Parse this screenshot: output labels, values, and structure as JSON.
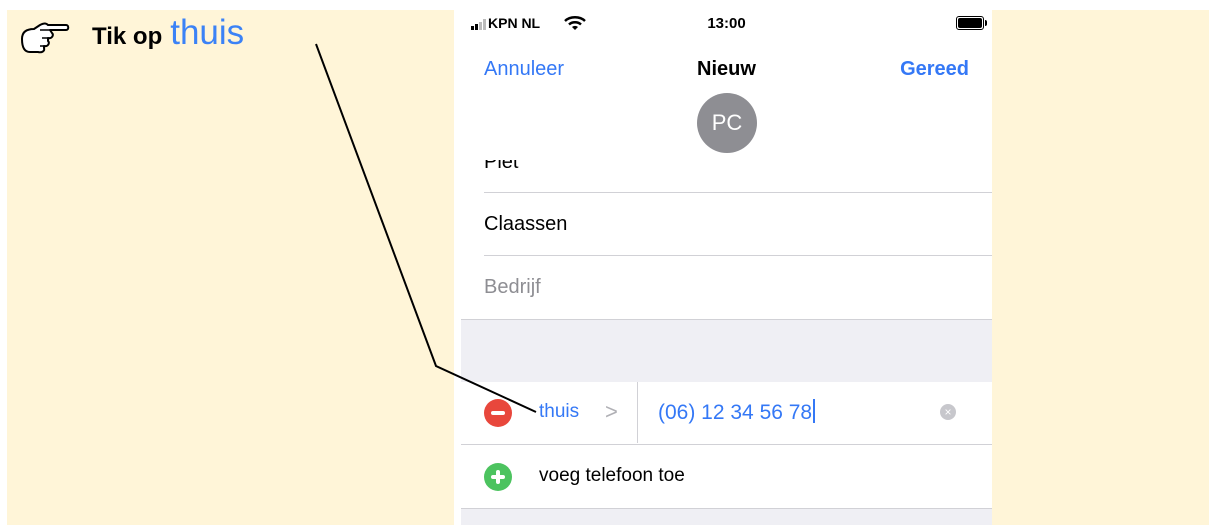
{
  "instruction": {
    "prefix": "Tik op",
    "highlight": "thuis",
    "pointer_icon": "hand-pointing-right-icon"
  },
  "status_bar": {
    "carrier": "KPN NL",
    "time": "13:00",
    "signal_icon": "signal-bars-icon",
    "wifi_icon": "wifi-icon",
    "battery_icon": "battery-icon"
  },
  "nav": {
    "cancel": "Annuleer",
    "title": "Nieuw",
    "done": "Gereed"
  },
  "avatar": {
    "initials": "PC"
  },
  "fields": {
    "first_name": "Piet",
    "last_name": "Claassen",
    "company_placeholder": "Bedrijf"
  },
  "phone": {
    "label": "thuis",
    "chevron": ">",
    "value": "(06) 12 34 56 78",
    "clear": "×"
  },
  "add_phone": {
    "label": "voeg telefoon toe"
  },
  "colors": {
    "accent": "#3478f6",
    "delete": "#e8473c",
    "add": "#4cc35f",
    "instruction_bg": "#fff5d8"
  }
}
